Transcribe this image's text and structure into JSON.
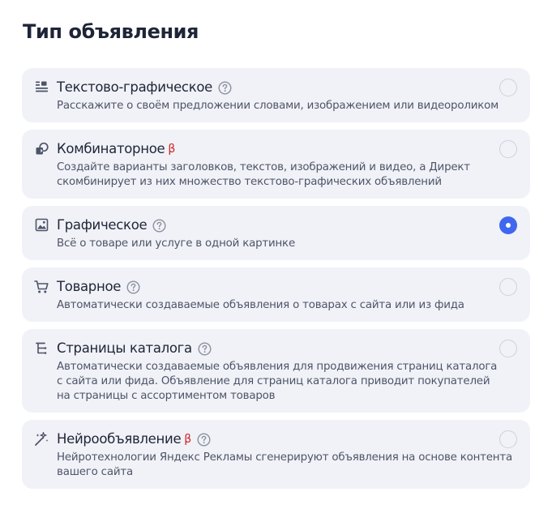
{
  "page": {
    "title": "Тип объявления"
  },
  "options": [
    {
      "title": "Текстово-графическое",
      "beta": "",
      "help": true,
      "icon": "text-graphic-icon",
      "selected": false,
      "desc": [
        "Расскажите о своём предложении словами, изображением или видеороликом"
      ]
    },
    {
      "title": "Комбинаторное",
      "beta": "β",
      "help": false,
      "icon": "combinatorial-icon",
      "selected": false,
      "desc": [
        "Создайте варианты заголовков, текстов, изображений и видео, а Директ",
        "скомбинирует из них множество текстово-графических объявлений"
      ]
    },
    {
      "title": "Графическое",
      "beta": "",
      "help": true,
      "icon": "image-icon",
      "selected": true,
      "desc": [
        "Всё о товаре или услуге в одной картинке"
      ]
    },
    {
      "title": "Товарное",
      "beta": "",
      "help": true,
      "icon": "cart-icon",
      "selected": false,
      "desc": [
        "Автоматически создаваемые объявления о товарах с сайта или из фида"
      ]
    },
    {
      "title": "Страницы каталога",
      "beta": "",
      "help": true,
      "icon": "catalog-tree-icon",
      "selected": false,
      "desc": [
        "Автоматически создаваемые объявления для продвижения страниц каталога",
        "с сайта или фида. Объявление для страниц каталога приводит покупателей",
        "на страницы с ассортиментом товаров"
      ]
    },
    {
      "title": "Нейрообъявление",
      "beta": "β",
      "help": true,
      "icon": "magic-wand-icon",
      "selected": false,
      "desc": [
        "Нейротехнологии Яндекс Рекламы сгенерируют объявления на основе контента",
        "вашего сайта"
      ]
    }
  ],
  "colors": {
    "card_bg": "#f0f2f7",
    "accent": "#3f67f0",
    "beta": "#d21f1f",
    "text": "#1f2537",
    "muted": "#4e5468"
  }
}
